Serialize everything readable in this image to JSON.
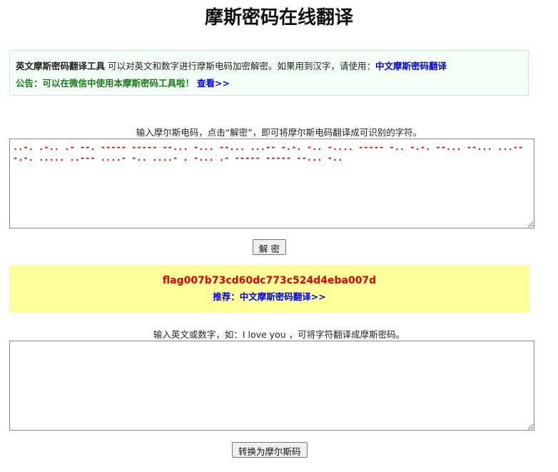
{
  "page": {
    "title": "摩斯密码在线翻译"
  },
  "intro": {
    "tool_name": "英文摩斯密码翻译工具",
    "description": " 可以对英文和数字进行摩斯电码加密解密。如果用到汉字，请使用：",
    "chinese_link": "中文摩斯密码翻译",
    "notice": "公告：可以在微信中使用本摩斯密码工具啦！",
    "notice_link": "查看>>"
  },
  "decode_section": {
    "hint": "输入摩尔斯电码，点击“解密”，即可将摩尔斯电码翻译成可识别的字符。",
    "input_value": "..-. .-.. .- --. ----- ----- --... -... --... ...-- -.-. -.. -.... ----- -.. -.-. --... --... ...-- -.-. ..... ..--- ....- -.. ....- . -... .- ----- ----- --... -..",
    "button_label": "解 密"
  },
  "result": {
    "output_text": "flag007b73cd60dc773c524d4eba007d",
    "recommend_prefix": "推荐：",
    "recommend_link": "中文摩斯密码翻译>>"
  },
  "encode_section": {
    "hint": "输入英文或数字，如：I love you ，可将字符翻译成摩斯密码。",
    "input_value": "",
    "button_label": "转换为摩尔斯码"
  }
}
